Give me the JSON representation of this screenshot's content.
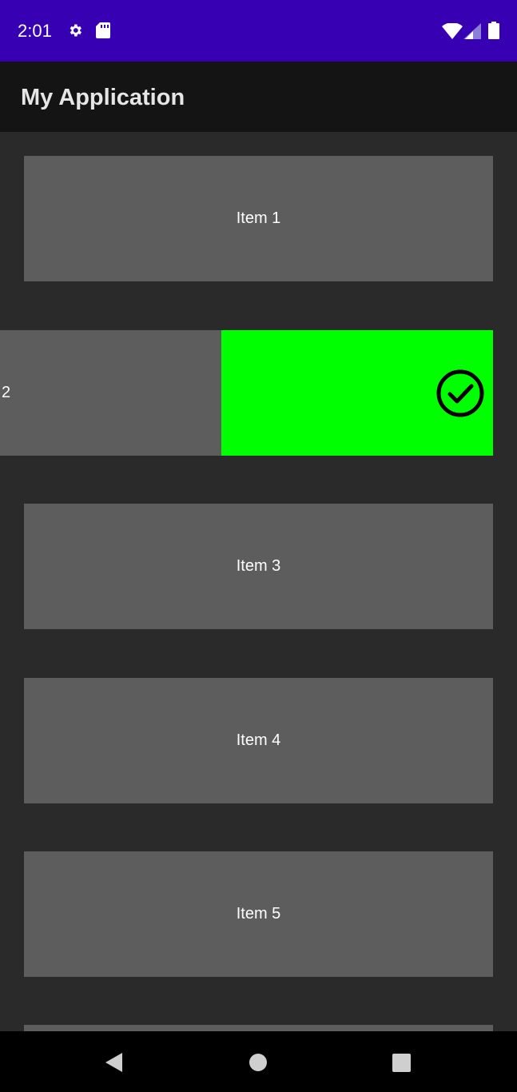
{
  "status_bar": {
    "time": "2:01",
    "background": "#3700b3",
    "icons_left": [
      "gear-icon",
      "sd-card-icon"
    ],
    "icons_right": [
      "wifi-icon",
      "cell-signal-icon",
      "battery-icon"
    ]
  },
  "app_bar": {
    "title": "My Application",
    "background": "#141414"
  },
  "list": {
    "items": [
      {
        "label": "Item 1"
      },
      {
        "label": "2",
        "swiped": true,
        "swipe_background": "#00ff00",
        "swipe_icon": "check-circle-icon"
      },
      {
        "label": "Item 3"
      },
      {
        "label": "Item 4"
      },
      {
        "label": "Item 5"
      }
    ],
    "item_color": "#5d5d5d",
    "background": "#2a2a2a"
  },
  "nav_bar": {
    "buttons": [
      "back-icon",
      "home-icon",
      "recents-icon"
    ]
  }
}
